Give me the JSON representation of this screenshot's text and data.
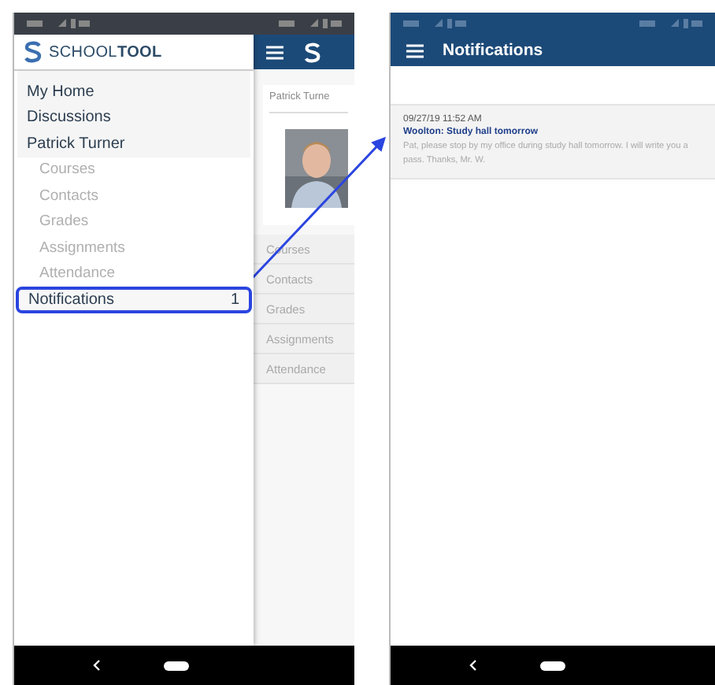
{
  "left_screen": {
    "drawer": {
      "logo": "SCHOOL**TOOL**",
      "items": [
        {
          "label": "My Home",
          "highlighted": false
        },
        {
          "label": "Discussions",
          "highlighted": false
        },
        {
          "label": "Patrick Turner",
          "highlighted": false,
          "children": [
            {
              "label": "Courses"
            },
            {
              "label": "Contacts"
            },
            {
              "label": "Grades"
            },
            {
              "label": "Assignments"
            },
            {
              "label": "Attendance"
            }
          ]
        },
        {
          "label": "Notifications",
          "count": "1",
          "highlighted": true
        }
      ]
    },
    "background": {
      "student_name": "Patrick Turne",
      "tabs": [
        "Courses",
        "Contacts",
        "Grades",
        "Assignments",
        "Attendance"
      ]
    }
  },
  "right_screen": {
    "app_bar": {
      "title": "Notifications"
    },
    "notifications": [
      {
        "date": "09/27/19 11:52 AM",
        "title": "Woolton: Study hall tomorrow",
        "body": "Pat, please stop by my office during study hall tomorrow. I will write you a pass. Thanks, Mr. W."
      }
    ]
  }
}
